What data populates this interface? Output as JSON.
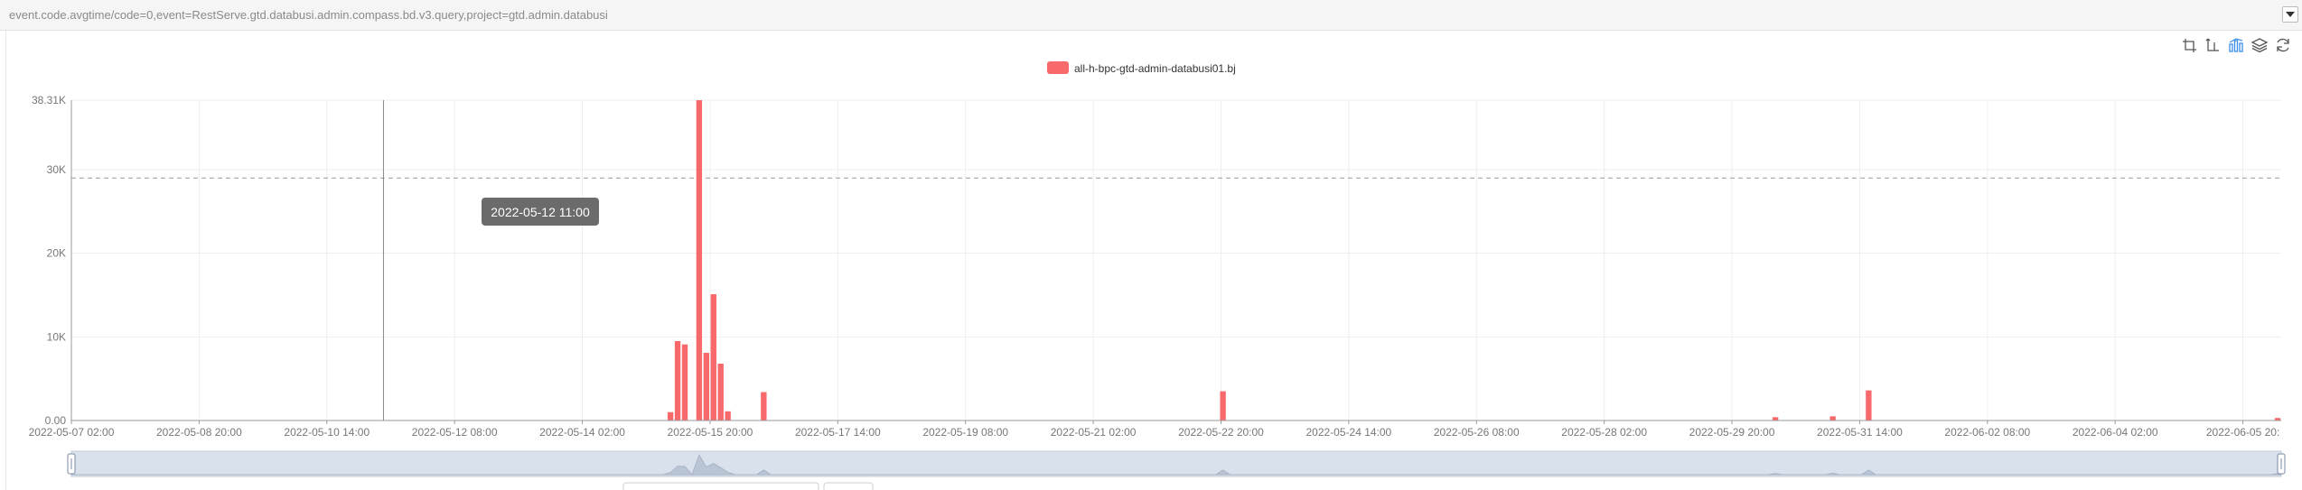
{
  "query": {
    "text": "event.code.avgtime/code=0,event=RestServe.gtd.databusi.admin.compass.bd.v3.query,project=gtd.admin.databusi"
  },
  "toolbox": {
    "icons": [
      "zoom-area-icon",
      "zoom-reset-icon",
      "bar-line-switch-icon",
      "stack-icon",
      "refresh-icon"
    ]
  },
  "tooltip": {
    "text": "2022-05-12 11:00"
  },
  "colors": {
    "series": "#f8696b",
    "grid": "#eeeeee",
    "axis": "#999999",
    "tooltip_bg": "#6b6b6b"
  },
  "chart_data": {
    "type": "bar",
    "legend": {
      "position": "top-center"
    },
    "series": [
      {
        "name": "all-h-bpc-gtd-admin-databusi01.bj",
        "color": "#f8696b",
        "x_start": "2022-05-07 02:00",
        "interval_hours": 3,
        "values": [
          0,
          0,
          0,
          0,
          0,
          0,
          0,
          0,
          0,
          0,
          0,
          0,
          0,
          0,
          0,
          0,
          0,
          0,
          0,
          0,
          0,
          0,
          0,
          0,
          0,
          0,
          0,
          0,
          0,
          0,
          0,
          0,
          0,
          0,
          0,
          0,
          0,
          0,
          0,
          0,
          0,
          0,
          0,
          0,
          0,
          0,
          0,
          0,
          0,
          0,
          0,
          0,
          0,
          0,
          0,
          0,
          0,
          0,
          0,
          0,
          0,
          0,
          0,
          0,
          0,
          0,
          0,
          0,
          0,
          0,
          0,
          0,
          0,
          0,
          0,
          0,
          0,
          0,
          0,
          0,
          0,
          0,
          0,
          1000,
          9500,
          9100,
          0,
          38310,
          8100,
          15100,
          6800,
          1100,
          0,
          0,
          0,
          0,
          3400,
          0,
          0,
          0,
          0,
          0,
          0,
          0,
          0,
          0,
          0,
          0,
          0,
          0,
          0,
          0,
          0,
          0,
          0,
          0,
          0,
          0,
          0,
          0,
          0,
          0,
          0,
          0,
          0,
          0,
          0,
          0,
          0,
          0,
          0,
          0,
          0,
          0,
          0,
          0,
          0,
          0,
          0,
          0,
          0,
          0,
          0,
          0,
          0,
          0,
          0,
          0,
          0,
          0,
          0,
          0,
          0,
          0,
          0,
          0,
          0,
          0,
          0,
          0,
          3500,
          0,
          0,
          0,
          0,
          0,
          0,
          0,
          0,
          0,
          0,
          0,
          0,
          0,
          0,
          0,
          0,
          0,
          0,
          0,
          0,
          0,
          0,
          0,
          0,
          0,
          0,
          0,
          0,
          0,
          0,
          0,
          0,
          0,
          0,
          0,
          0,
          0,
          0,
          0,
          0,
          0,
          0,
          0,
          0,
          0,
          0,
          0,
          0,
          0,
          0,
          0,
          0,
          0,
          0,
          0,
          0,
          0,
          0,
          0,
          0,
          0,
          0,
          0,
          0,
          0,
          0,
          0,
          0,
          0,
          0,
          0,
          0,
          0,
          0,
          0,
          0,
          400,
          0,
          0,
          0,
          0,
          0,
          0,
          0,
          500,
          0,
          0,
          0,
          0,
          3600,
          0,
          0,
          0,
          0,
          0,
          0,
          0,
          0,
          0,
          0,
          0,
          0,
          0,
          0,
          0,
          0,
          0,
          0,
          0,
          0,
          0,
          0,
          0,
          0,
          0,
          0,
          0,
          0,
          0,
          0,
          0,
          0,
          0,
          0,
          0,
          0,
          0,
          0,
          0,
          0,
          0,
          0,
          0,
          0,
          0,
          0,
          0,
          0,
          0,
          0,
          0,
          0,
          0,
          0,
          0,
          0,
          300
        ]
      }
    ],
    "y_axis": {
      "min": 0,
      "max": 38310,
      "ticks": [
        0,
        10000,
        20000,
        30000,
        38310
      ],
      "tick_labels": [
        "0.00",
        "10K",
        "20K",
        "30K",
        "38.31K"
      ]
    },
    "x_axis": {
      "tick_labels": [
        "2022-05-07 02:00",
        "2022-05-08 20:00",
        "2022-05-10 14:00",
        "2022-05-12 08:00",
        "2022-05-14 02:00",
        "2022-05-15 20:00",
        "2022-05-17 14:00",
        "2022-05-19 08:00",
        "2022-05-21 02:00",
        "2022-05-22 20:00",
        "2022-05-24 14:00",
        "2022-05-26 08:00",
        "2022-05-28 02:00",
        "2022-05-29 20:00",
        "2022-05-31 14:00",
        "2022-06-02 08:00",
        "2022-06-04 02:00",
        "2022-06-05 20:"
      ]
    },
    "mark_line_value": 29000,
    "cursor_x": "2022-05-12 11:00",
    "grid": true,
    "data_zoom": true
  }
}
